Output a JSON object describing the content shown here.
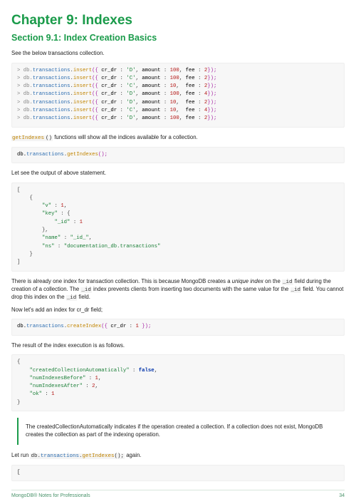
{
  "chapter_title": "Chapter 9: Indexes",
  "section_title": "Section 9.1: Index Creation Basics",
  "para_intro": "See the below transactions collection.",
  "code1_lines": [
    {
      "pre": "> db.",
      "obj": "transactions",
      "dot": ".",
      "fn": "insert",
      "args_open": "({ ",
      "k1": "cr_dr ",
      "c1": ": ",
      "v1": "'D'",
      "c2": ", ",
      "k2": "amount ",
      "c3": ": ",
      "v2": "100",
      "c4": ", ",
      "k3": "fee ",
      "c5": ": ",
      "v3": "2",
      "args_close": "});"
    },
    {
      "pre": "> db.",
      "obj": "transactions",
      "dot": ".",
      "fn": "insert",
      "args_open": "({ ",
      "k1": "cr_dr ",
      "c1": ": ",
      "v1": "'C'",
      "c2": ", ",
      "k2": "amount ",
      "c3": ": ",
      "v2": "100",
      "c4": ", ",
      "k3": "fee ",
      "c5": ": ",
      "v3": "2",
      "args_close": "});"
    },
    {
      "pre": "> db.",
      "obj": "transactions",
      "dot": ".",
      "fn": "insert",
      "args_open": "({ ",
      "k1": "cr_dr ",
      "c1": ": ",
      "v1": "'C'",
      "c2": ", ",
      "k2": "amount ",
      "c3": ": ",
      "v2": "10",
      "c4": ",  ",
      "k3": "fee ",
      "c5": ": ",
      "v3": "2",
      "args_close": "});"
    },
    {
      "pre": "> db.",
      "obj": "transactions",
      "dot": ".",
      "fn": "insert",
      "args_open": "({ ",
      "k1": "cr_dr ",
      "c1": ": ",
      "v1": "'D'",
      "c2": ", ",
      "k2": "amount ",
      "c3": ": ",
      "v2": "100",
      "c4": ", ",
      "k3": "fee ",
      "c5": ": ",
      "v3": "4",
      "args_close": "});"
    },
    {
      "pre": "> db.",
      "obj": "transactions",
      "dot": ".",
      "fn": "insert",
      "args_open": "({ ",
      "k1": "cr_dr ",
      "c1": ": ",
      "v1": "'D'",
      "c2": ", ",
      "k2": "amount ",
      "c3": ": ",
      "v2": "10",
      "c4": ",  ",
      "k3": "fee ",
      "c5": ": ",
      "v3": "2",
      "args_close": "});"
    },
    {
      "pre": "> db.",
      "obj": "transactions",
      "dot": ".",
      "fn": "insert",
      "args_open": "({ ",
      "k1": "cr_dr ",
      "c1": ": ",
      "v1": "'C'",
      "c2": ", ",
      "k2": "amount ",
      "c3": ": ",
      "v2": "10",
      "c4": ",  ",
      "k3": "fee ",
      "c5": ": ",
      "v3": "4",
      "args_close": "});"
    },
    {
      "pre": "> db.",
      "obj": "transactions",
      "dot": ".",
      "fn": "insert",
      "args_open": "({ ",
      "k1": "cr_dr ",
      "c1": ": ",
      "v1": "'D'",
      "c2": ", ",
      "k2": "amount ",
      "c3": ": ",
      "v2": "100",
      "c4": ", ",
      "k3": "fee ",
      "c5": ": ",
      "v3": "2",
      "args_close": "});"
    }
  ],
  "para_getindexes_pre": "getIndexes",
  "para_getindexes_post": " functions will show all the indices available for a collection.",
  "code2": {
    "pre": "db.",
    "obj": "transactions",
    "dot": ".",
    "fn": "getIndexes",
    "args": "();"
  },
  "para_output": "Let see the output of above statement.",
  "code3": "[\n    {\n        \"v\" : 1,\n        \"key\" : {\n            \"_id\" : 1\n        },\n        \"name\" : \"_id_\",\n        \"ns\" : \"documentation_db.transactions\"\n    }\n]",
  "code3_tokens": [
    {
      "t": "[",
      "c": "tk-pn"
    },
    {
      "t": "\n    {",
      "c": "tk-pn"
    },
    {
      "t": "\n        \"v\"",
      "c": "tk-key"
    },
    {
      "t": " : ",
      "c": "tk-pn"
    },
    {
      "t": "1",
      "c": "tk-num"
    },
    {
      "t": ",",
      "c": "tk-pn"
    },
    {
      "t": "\n        \"key\"",
      "c": "tk-key"
    },
    {
      "t": " : {",
      "c": "tk-pn"
    },
    {
      "t": "\n            \"_id\"",
      "c": "tk-key"
    },
    {
      "t": " : ",
      "c": "tk-pn"
    },
    {
      "t": "1",
      "c": "tk-num"
    },
    {
      "t": "\n        },",
      "c": "tk-pn"
    },
    {
      "t": "\n        \"name\"",
      "c": "tk-key"
    },
    {
      "t": " : ",
      "c": "tk-pn"
    },
    {
      "t": "\"_id_\"",
      "c": "tk-str"
    },
    {
      "t": ",",
      "c": "tk-pn"
    },
    {
      "t": "\n        \"ns\"",
      "c": "tk-key"
    },
    {
      "t": " : ",
      "c": "tk-pn"
    },
    {
      "t": "\"documentation_db.transactions\"",
      "c": "tk-str"
    },
    {
      "t": "\n    }",
      "c": "tk-pn"
    },
    {
      "t": "\n]",
      "c": "tk-pn"
    }
  ],
  "para_explain1a": "There is already one index for transaction collection. This is because MongoDB creates a ",
  "para_explain1b": "unique index",
  "para_explain1c": " on the ",
  "para_explain1d": "_id",
  "para_explain1e": " field during the creation of a collection. The ",
  "para_explain1f": "_id",
  "para_explain1g": " index prevents clients from inserting two documents with the same value for the ",
  "para_explain1h": "_id",
  "para_explain1i": " field. You cannot drop this index on the ",
  "para_explain1j": "_id",
  "para_explain1k": " field.",
  "para_addindex": "Now let's add an index for cr_dr field;",
  "code4": {
    "pre": "db.",
    "obj": "transactions",
    "dot": ".",
    "fn": "createIndex",
    "ao": "({ ",
    "key": "cr_dr",
    "col": " : ",
    "val": "1",
    "ac": " });"
  },
  "para_result": "The result of the index execution is as follows.",
  "code5_tokens": [
    {
      "t": "{",
      "c": "tk-pn"
    },
    {
      "t": "\n    \"createdCollectionAutomatically\"",
      "c": "tk-key"
    },
    {
      "t": " : ",
      "c": "tk-pn"
    },
    {
      "t": "false",
      "c": "tk-bool"
    },
    {
      "t": ",",
      "c": "tk-pn"
    },
    {
      "t": "\n    \"numIndexesBefore\"",
      "c": "tk-key"
    },
    {
      "t": " : ",
      "c": "tk-pn"
    },
    {
      "t": "1",
      "c": "tk-num"
    },
    {
      "t": ",",
      "c": "tk-pn"
    },
    {
      "t": "\n    \"numIndexesAfter\"",
      "c": "tk-key"
    },
    {
      "t": " : ",
      "c": "tk-pn"
    },
    {
      "t": "2",
      "c": "tk-num"
    },
    {
      "t": ",",
      "c": "tk-pn"
    },
    {
      "t": "\n    \"ok\"",
      "c": "tk-key"
    },
    {
      "t": " : ",
      "c": "tk-pn"
    },
    {
      "t": "1",
      "c": "tk-num"
    },
    {
      "t": "\n}",
      "c": "tk-pn"
    }
  ],
  "note_text": "The createdCollectionAutomatically indicates if the operation created a collection. If a collection does not exist, MongoDB creates the collection as part of the indexing operation.",
  "para_letrun_a": "Let run ",
  "para_letrun_b": "db.",
  "para_letrun_c": "transactions",
  "para_letrun_d": ".",
  "para_letrun_e": "getIndexes",
  "para_letrun_f": "();",
  "para_letrun_g": " again.",
  "code6": "[",
  "footer_left": "MongoDB® Notes for Professionals",
  "footer_right": "34"
}
